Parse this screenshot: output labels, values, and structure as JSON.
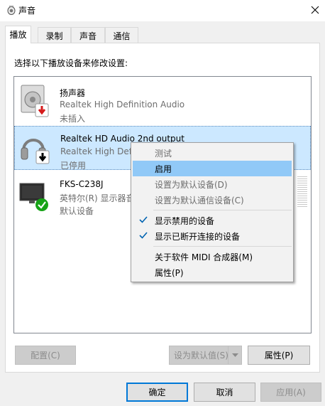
{
  "window": {
    "title": "声音",
    "close_label": "✕"
  },
  "tabs": [
    {
      "label": "播放",
      "active": true
    },
    {
      "label": "录制",
      "active": false
    },
    {
      "label": "声音",
      "active": false
    },
    {
      "label": "通信",
      "active": false
    }
  ],
  "instruction": "选择以下播放设备来修改设置:",
  "devices": [
    {
      "name": "扬声器",
      "line2": "Realtek High Definition Audio",
      "line3": "未插入",
      "icon": "speaker-icon",
      "badge": "unplugged-red-arrow"
    },
    {
      "name": "Realtek HD Audio 2nd output",
      "line2": "Realtek High Definition Audio",
      "line3": "已停用",
      "icon": "headphones-icon",
      "badge": "disabled-black-arrow"
    },
    {
      "name": "FKS-C238J",
      "line2": "英特尔(R) 显示器音频",
      "line3": "默认设备",
      "icon": "monitor-icon",
      "badge": "default-green-check"
    }
  ],
  "context_menu": {
    "items": [
      {
        "label": "测试",
        "disabled": true,
        "checked": false
      },
      {
        "label": "启用",
        "disabled": false,
        "checked": false,
        "hover": true
      },
      {
        "label": "设置为默认设备(D)",
        "disabled": true,
        "checked": false
      },
      {
        "label": "设置为默认通信设备(C)",
        "disabled": true,
        "checked": false
      },
      {
        "label": "显示禁用的设备",
        "disabled": false,
        "checked": true
      },
      {
        "label": "显示已断开连接的设备",
        "disabled": false,
        "checked": true
      },
      {
        "label": "关于软件 MIDI 合成器(M)",
        "disabled": false,
        "checked": false
      },
      {
        "label": "属性(P)",
        "disabled": false,
        "checked": false
      }
    ]
  },
  "panel_buttons": {
    "configure": "配置(C)",
    "set_default": "设为默认值(S)",
    "properties": "属性(P)"
  },
  "dialog_buttons": {
    "ok": "确定",
    "cancel": "取消",
    "apply": "应用(A)"
  },
  "colors": {
    "selection": "#cce8ff",
    "menu_hover": "#91c9f7",
    "accent": "#0078d7",
    "check": "#0063b1",
    "badge_green": "#17a317",
    "badge_red": "#d51a1a"
  }
}
